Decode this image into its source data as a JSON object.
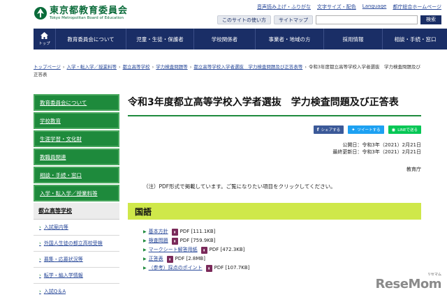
{
  "header": {
    "title_ja": "東京都教育委員会",
    "title_en": "Tokyo Metropolitan Board of Education",
    "util_links": [
      "音声読み上げ・ふりがな",
      "文字サイズ・配色",
      "Language",
      "都庁総合ホームページ"
    ],
    "util_buttons": [
      "このサイトの使い方",
      "サイトマップ"
    ],
    "search_label": "検索",
    "search_value": ""
  },
  "nav": {
    "home_label": "トップ",
    "items": [
      "教育委員会について",
      "児童・生徒・保護者",
      "学校関係者",
      "事業者・地域の方",
      "採用情報",
      "相談・手続・窓口"
    ]
  },
  "breadcrumb": {
    "items": [
      "トップページ",
      "入学・転入学／授業料等",
      "都立高等学校",
      "学力検査問題等",
      "都立高等学校入学者選抜　学力検査問題及び正答表等"
    ],
    "current": "令和3年度都立高等学校入学者選抜　学力検査問題及び正答表"
  },
  "sidebar": {
    "items": [
      "教育委員会について",
      "学校教育",
      "生涯学習・文化財",
      "教職員関連",
      "相談・手続・窓口",
      "入学・転入学／授業料等"
    ],
    "section_head": "都立高等学校",
    "sub_items": [
      "入試案内等",
      "外国人生徒の都立高校受検",
      "募集・応募状況等",
      "転学・編入学情報",
      "入試Q＆A"
    ]
  },
  "main": {
    "title": "令和3年度都立高等学校入学者選抜　学力検査問題及び正答表",
    "share": [
      "シェアする",
      "ツイートする",
      "LINEで送る"
    ],
    "published": "公開日：令和3年（2021）2月21日",
    "updated": "最終更新日：令和3年（2021）2月21日",
    "department": "教育庁",
    "note": "（注）PDF形式で掲載しています。ご覧になりたい項目をクリックしてください。",
    "section": "国語",
    "documents": [
      {
        "name": "基本方針",
        "format": "PDF",
        "size": "[111.1KB]"
      },
      {
        "name": "検査問題",
        "format": "PDF",
        "size": "[759.9KB]"
      },
      {
        "name": "マークシート解答用紙",
        "format": "PDF",
        "size": "[472.3KB]"
      },
      {
        "name": "正答表",
        "format": "PDF",
        "size": "[2.8MB]"
      },
      {
        "name": "（参考）採点のポイント",
        "format": "PDF",
        "size": "[107.7KB]"
      }
    ]
  },
  "watermark": {
    "small": "リセマム",
    "main": "ReseMom"
  },
  "colors": {
    "brand_green": "#1e8a3c",
    "nav_blue": "#1a2e66",
    "section_lime": "#cfe84a",
    "facebook": "#3b5998",
    "twitter": "#1da1f2",
    "line": "#06c755"
  }
}
